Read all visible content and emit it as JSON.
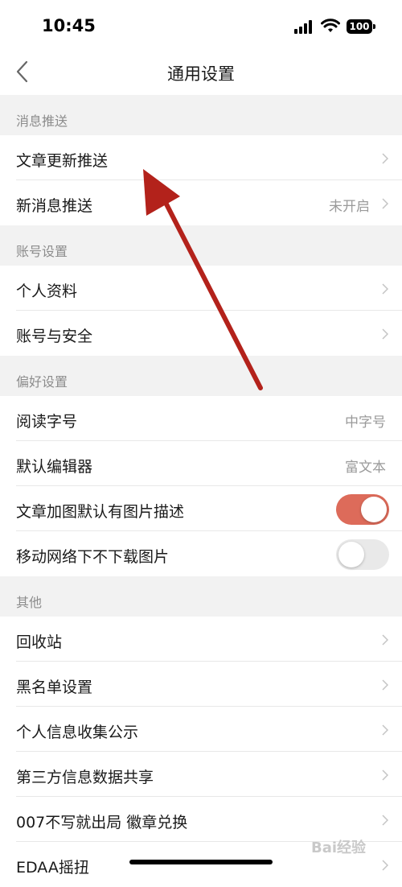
{
  "status_bar": {
    "time": "10:45",
    "battery": "100"
  },
  "nav": {
    "title": "通用设置"
  },
  "sections": [
    {
      "header": "消息推送",
      "rows": [
        {
          "label": "文章更新推送",
          "value": ""
        },
        {
          "label": "新消息推送",
          "value": "未开启"
        }
      ]
    },
    {
      "header": "账号设置",
      "rows": [
        {
          "label": "个人资料",
          "value": ""
        },
        {
          "label": "账号与安全",
          "value": ""
        }
      ]
    },
    {
      "header": "偏好设置",
      "rows": [
        {
          "label": "阅读字号",
          "value": "中字号"
        },
        {
          "label": "默认编辑器",
          "value": "富文本"
        },
        {
          "label": "文章加图默认有图片描述",
          "toggle": true
        },
        {
          "label": "移动网络下不下载图片",
          "toggle": false
        }
      ]
    },
    {
      "header": "其他",
      "rows": [
        {
          "label": "回收站"
        },
        {
          "label": "黑名单设置"
        },
        {
          "label": "个人信息收集公示"
        },
        {
          "label": "第三方信息数据共享"
        },
        {
          "label": "007不写就出局 徽章兑换"
        },
        {
          "label": "EDAA摇扭"
        }
      ]
    }
  ],
  "watermark": {
    "text": "Bai经验"
  },
  "colors": {
    "accent": "#dd6b5a",
    "annotation": "#b3221b"
  }
}
